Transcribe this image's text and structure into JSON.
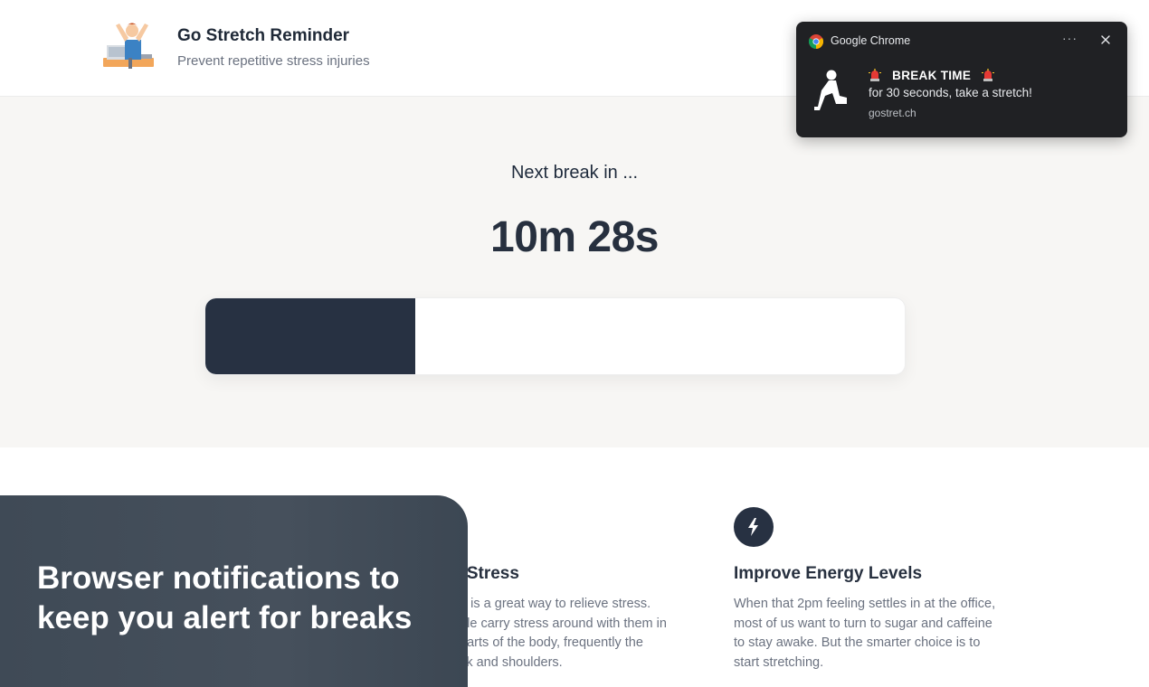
{
  "header": {
    "title": "Go Stretch Reminder",
    "subtitle": "Prevent repetitive stress injuries",
    "logo_icon": "person-stretching-at-desk-icon"
  },
  "timer": {
    "label": "Next break in ...",
    "countdown": "10m 28s",
    "progress_fraction": 0.3
  },
  "features": [
    {
      "icon": "relax-icon",
      "title": "e Stress",
      "text_lines": [
        "ng is a great way to relieve stress.",
        "ople carry stress around with them in",
        "t parts of the body, frequently the",
        "eck and shoulders."
      ]
    },
    {
      "icon": "lightning-bolt-icon",
      "title": "Improve Energy Levels",
      "text_lines": [
        "When that 2pm feeling settles in at the office,",
        "most of us want to turn to sugar and caffeine",
        "to stay awake. But the smarter choice is to",
        "start stretching."
      ]
    }
  ],
  "caption": {
    "text": "Browser notifications to keep you alert for breaks"
  },
  "notification": {
    "app_name": "Google Chrome",
    "more_label": "···",
    "title": "BREAK TIME",
    "body": "for 30 seconds, take a stretch!",
    "origin": "gostret.ch",
    "image_icon": "lunge-stretch-icon"
  },
  "colors": {
    "accent_dark": "#273142",
    "hero_bg": "#f7f6f4",
    "notification_bg": "#202124"
  }
}
